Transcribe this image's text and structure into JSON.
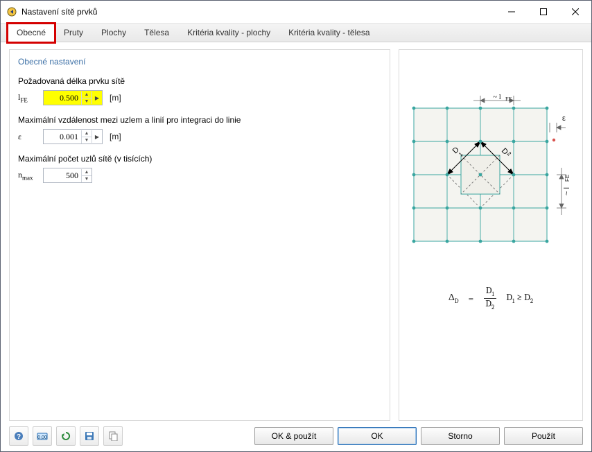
{
  "window": {
    "title": "Nastavení sítě prvků"
  },
  "tabs": {
    "items": [
      {
        "label": "Obecné"
      },
      {
        "label": "Pruty"
      },
      {
        "label": "Plochy"
      },
      {
        "label": "Tělesa"
      },
      {
        "label": "Kritéria kvality - plochy"
      },
      {
        "label": "Kritéria kvality - tělesa"
      }
    ]
  },
  "section": {
    "title": "Obecné nastavení"
  },
  "field1": {
    "label": "Požadovaná délka prvku sítě",
    "symbol_html": "l<span class='sub'>FE</span>",
    "value": "0.500",
    "unit": "[m]"
  },
  "field2": {
    "label": "Maximální vzdálenost mezi uzlem a linií pro integraci do linie",
    "symbol": "ε",
    "value": "0.001",
    "unit": "[m]"
  },
  "field3": {
    "label": "Maximální počet uzlů sítě (v tisících)",
    "symbol_html": "n<span class='sub'>max</span>",
    "value": "500"
  },
  "diagram": {
    "top_label": "~ lFE",
    "right_label": "~ lFE",
    "eps_label": "ε",
    "d1": "D1",
    "d2": "D2"
  },
  "formula": {
    "lhs_html": "Δ<span class='sub'>D</span>",
    "eq": "=",
    "num_html": "D<span class='sub'>1</span>",
    "den_html": "D<span class='sub'>2</span>",
    "cond_html": "D<span class='sub'>1</span> ≥ D<span class='sub'>2</span>"
  },
  "buttons": {
    "ok_apply": "OK & použít",
    "ok": "OK",
    "cancel": "Storno",
    "apply": "Použít"
  }
}
